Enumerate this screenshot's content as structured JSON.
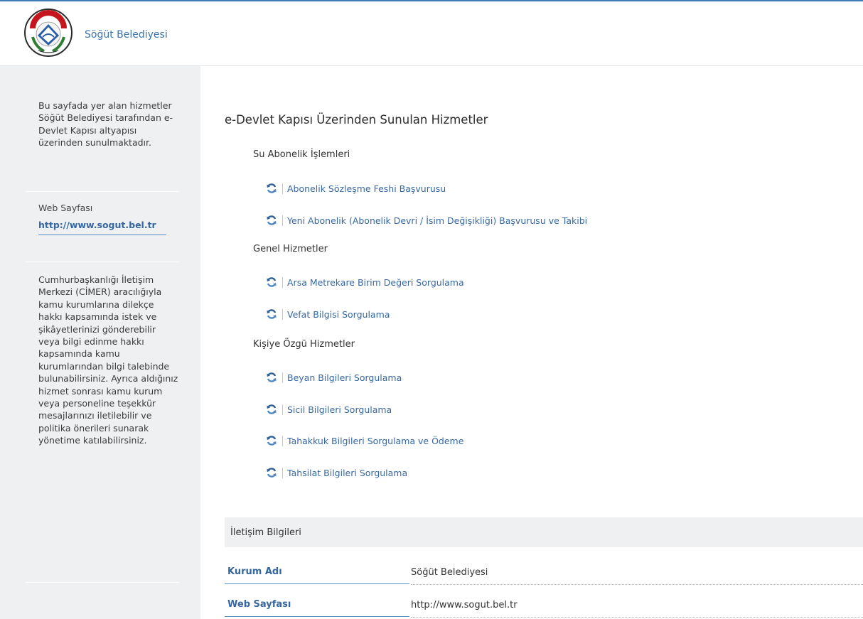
{
  "header": {
    "brand": "Söğüt Belediyesi",
    "logo_alt": "SÖĞÜT BELEDİYESİ 1923"
  },
  "sidebar": {
    "intro": "Bu sayfada yer alan hizmetler Söğüt Belediyesi tarafından e-Devlet Kapısı altyapısı üzerinden sunulmaktadır.",
    "web_label": "Web Sayfası",
    "web_link": "http://www.sogut.bel.tr",
    "cimer": "Cumhurbaşkanlığı İletişim Merkezi (CİMER) aracılığıyla kamu kurumlarına dilekçe hakkı kapsamında istek ve şikâyetlerinizi gönderebilir veya bilgi edinme hakkı kapsamında kamu kurumlarından bilgi talebinde bulunabilirsiniz. Ayrıca aldığınız hizmet sonrası kamu kurum veya personeline teşekkür mesajlarınızı iletilebilir ve politika önerileri sunarak yönetime katılabilirsiniz."
  },
  "main": {
    "title": "e-Devlet Kapısı Üzerinden Sunulan Hizmetler",
    "groups": [
      {
        "title": "Su Abonelik İşlemleri",
        "items": [
          "Abonelik Sözleşme Feshi Başvurusu",
          "Yeni Abonelik (Abonelik Devri / İsim Değişikliği) Başvurusu ve Takibi"
        ]
      },
      {
        "title": "Genel Hizmetler",
        "items": [
          "Arsa Metrekare Birim Değeri Sorgulama",
          "Vefat Bilgisi Sorgulama"
        ]
      },
      {
        "title": "Kişiye Özgü Hizmetler",
        "items": [
          "Beyan Bilgileri Sorgulama",
          "Sicil Bilgileri Sorgulama",
          "Tahakkuk Bilgileri Sorgulama ve Ödeme",
          "Tahsilat Bilgileri Sorgulama"
        ]
      }
    ],
    "contact": {
      "title": "İletişim Bilgileri",
      "rows": [
        {
          "label": "Kurum Adı",
          "value": "Söğüt Belediyesi"
        },
        {
          "label": "Web Sayfası",
          "value": "http://www.sogut.bel.tr"
        }
      ]
    }
  },
  "icons": {
    "service_icon": "refresh-icon"
  },
  "colors": {
    "link": "#3568a4",
    "accent": "#3d7ab8",
    "sidebar_bg": "#eef0f2"
  }
}
